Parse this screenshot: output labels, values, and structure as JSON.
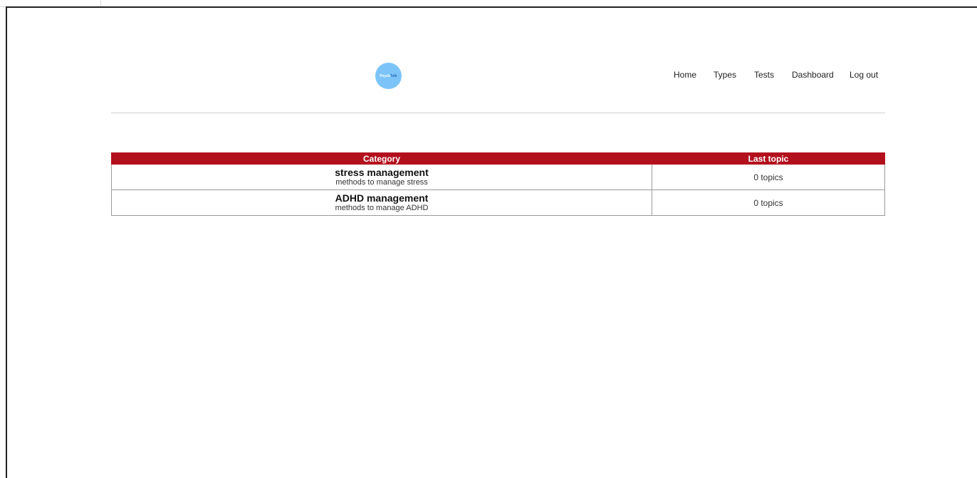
{
  "header": {
    "logo": {
      "part1": "Psych",
      "part2": "Talk",
      "color": "#7cc4f8"
    },
    "nav": {
      "home": "Home",
      "types": "Types",
      "tests": "Tests",
      "dashboard": "Dashboard",
      "logout": "Log out"
    }
  },
  "table": {
    "headers": {
      "category": "Category",
      "last_topic": "Last topic"
    },
    "header_color": "#b3101e",
    "rows": [
      {
        "title": "stress management",
        "description": "methods to manage stress",
        "last_topic": "0 topics"
      },
      {
        "title": "ADHD management",
        "description": "methods to manage ADHD",
        "last_topic": "0 topics"
      }
    ]
  }
}
